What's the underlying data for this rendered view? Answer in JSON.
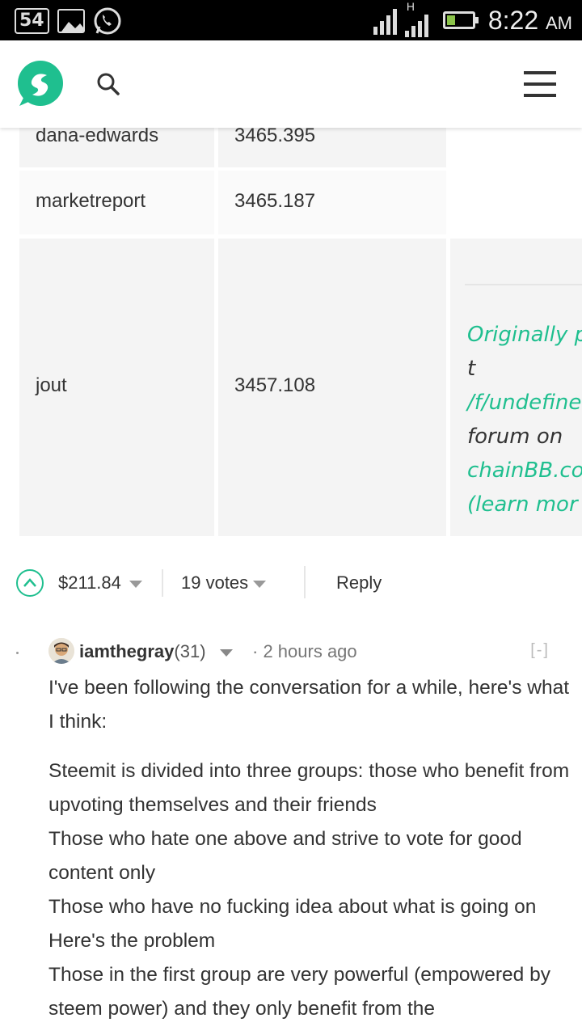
{
  "status_bar": {
    "notification_count": "54",
    "network": "H",
    "time": "8:22",
    "ampm": "AM"
  },
  "header": {
    "logo_icon": "steemit-logo",
    "search_icon": "search-icon",
    "menu_icon": "menu-icon"
  },
  "table": {
    "rows": [
      {
        "name": "dana-edwards",
        "value": "3465.395"
      },
      {
        "name": "marketreport",
        "value": "3465.187"
      },
      {
        "name": "jout",
        "value": "3457.108"
      }
    ]
  },
  "embed": {
    "link1": "Originally posted",
    "mid1": " in t",
    "link2": "/f/undefine",
    "mid2": "forum on",
    "link3": "chainBB.co",
    "link4": "(learn mor"
  },
  "post_actions": {
    "payout": "$211.84",
    "votes": "19 votes",
    "reply": "Reply"
  },
  "comment": {
    "author": "iamthegray",
    "reputation": "(31)",
    "separator": "·",
    "time": "2 hours ago",
    "collapse": "[-]",
    "paragraph1": "I've been following the conversation for a while, here's what I think:",
    "lines": [
      "Steemit is divided into three groups: those who benefit from upvoting themselves and their friends",
      "Those who hate one above and strive to vote for good content only",
      "Those who have no fucking idea about what is going on",
      "Here's the problem",
      "Those in the first group are very powerful (empowered by steem power) and they only benefit from the"
    ]
  },
  "colors": {
    "accent": "#1fbf8f",
    "statusbar": "#000000",
    "table_cell": "#f4f4f4"
  }
}
